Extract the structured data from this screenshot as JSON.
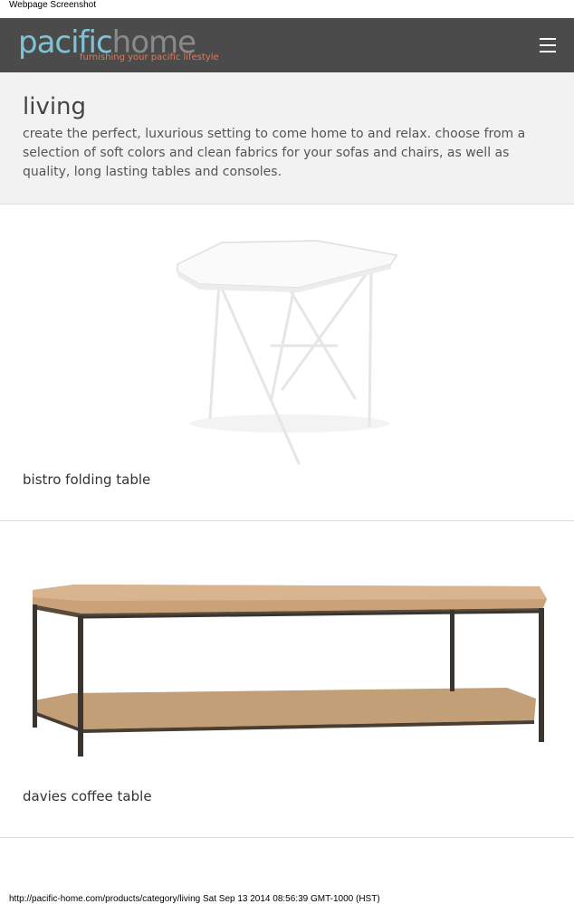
{
  "screenshot_caption": "Webpage Screenshot",
  "header": {
    "logo_part1": "pacific",
    "logo_part2": "home",
    "tagline": "furnishing your pacific lifestyle",
    "menu_icon": "hamburger-menu-icon",
    "colors": {
      "background": "#4b4b4b",
      "logo_blue": "#7fc4d6",
      "logo_grey": "#8a8a8a",
      "tagline": "#e07a58"
    }
  },
  "category": {
    "title": "living",
    "description": "create the perfect, luxurious setting to come home to and relax. choose from a selection of soft colors and clean fabrics for your sofas and chairs, as well as quality, long lasting tables and consoles."
  },
  "products": [
    {
      "name": "bistro folding table",
      "image": "white-folding-table"
    },
    {
      "name": "davies coffee table",
      "image": "wood-metal-coffee-table"
    }
  ],
  "footer": {
    "status_line": "http://pacific-home.com/products/category/living Sat Sep 13 2014 08:56:39 GMT-1000 (HST)"
  }
}
